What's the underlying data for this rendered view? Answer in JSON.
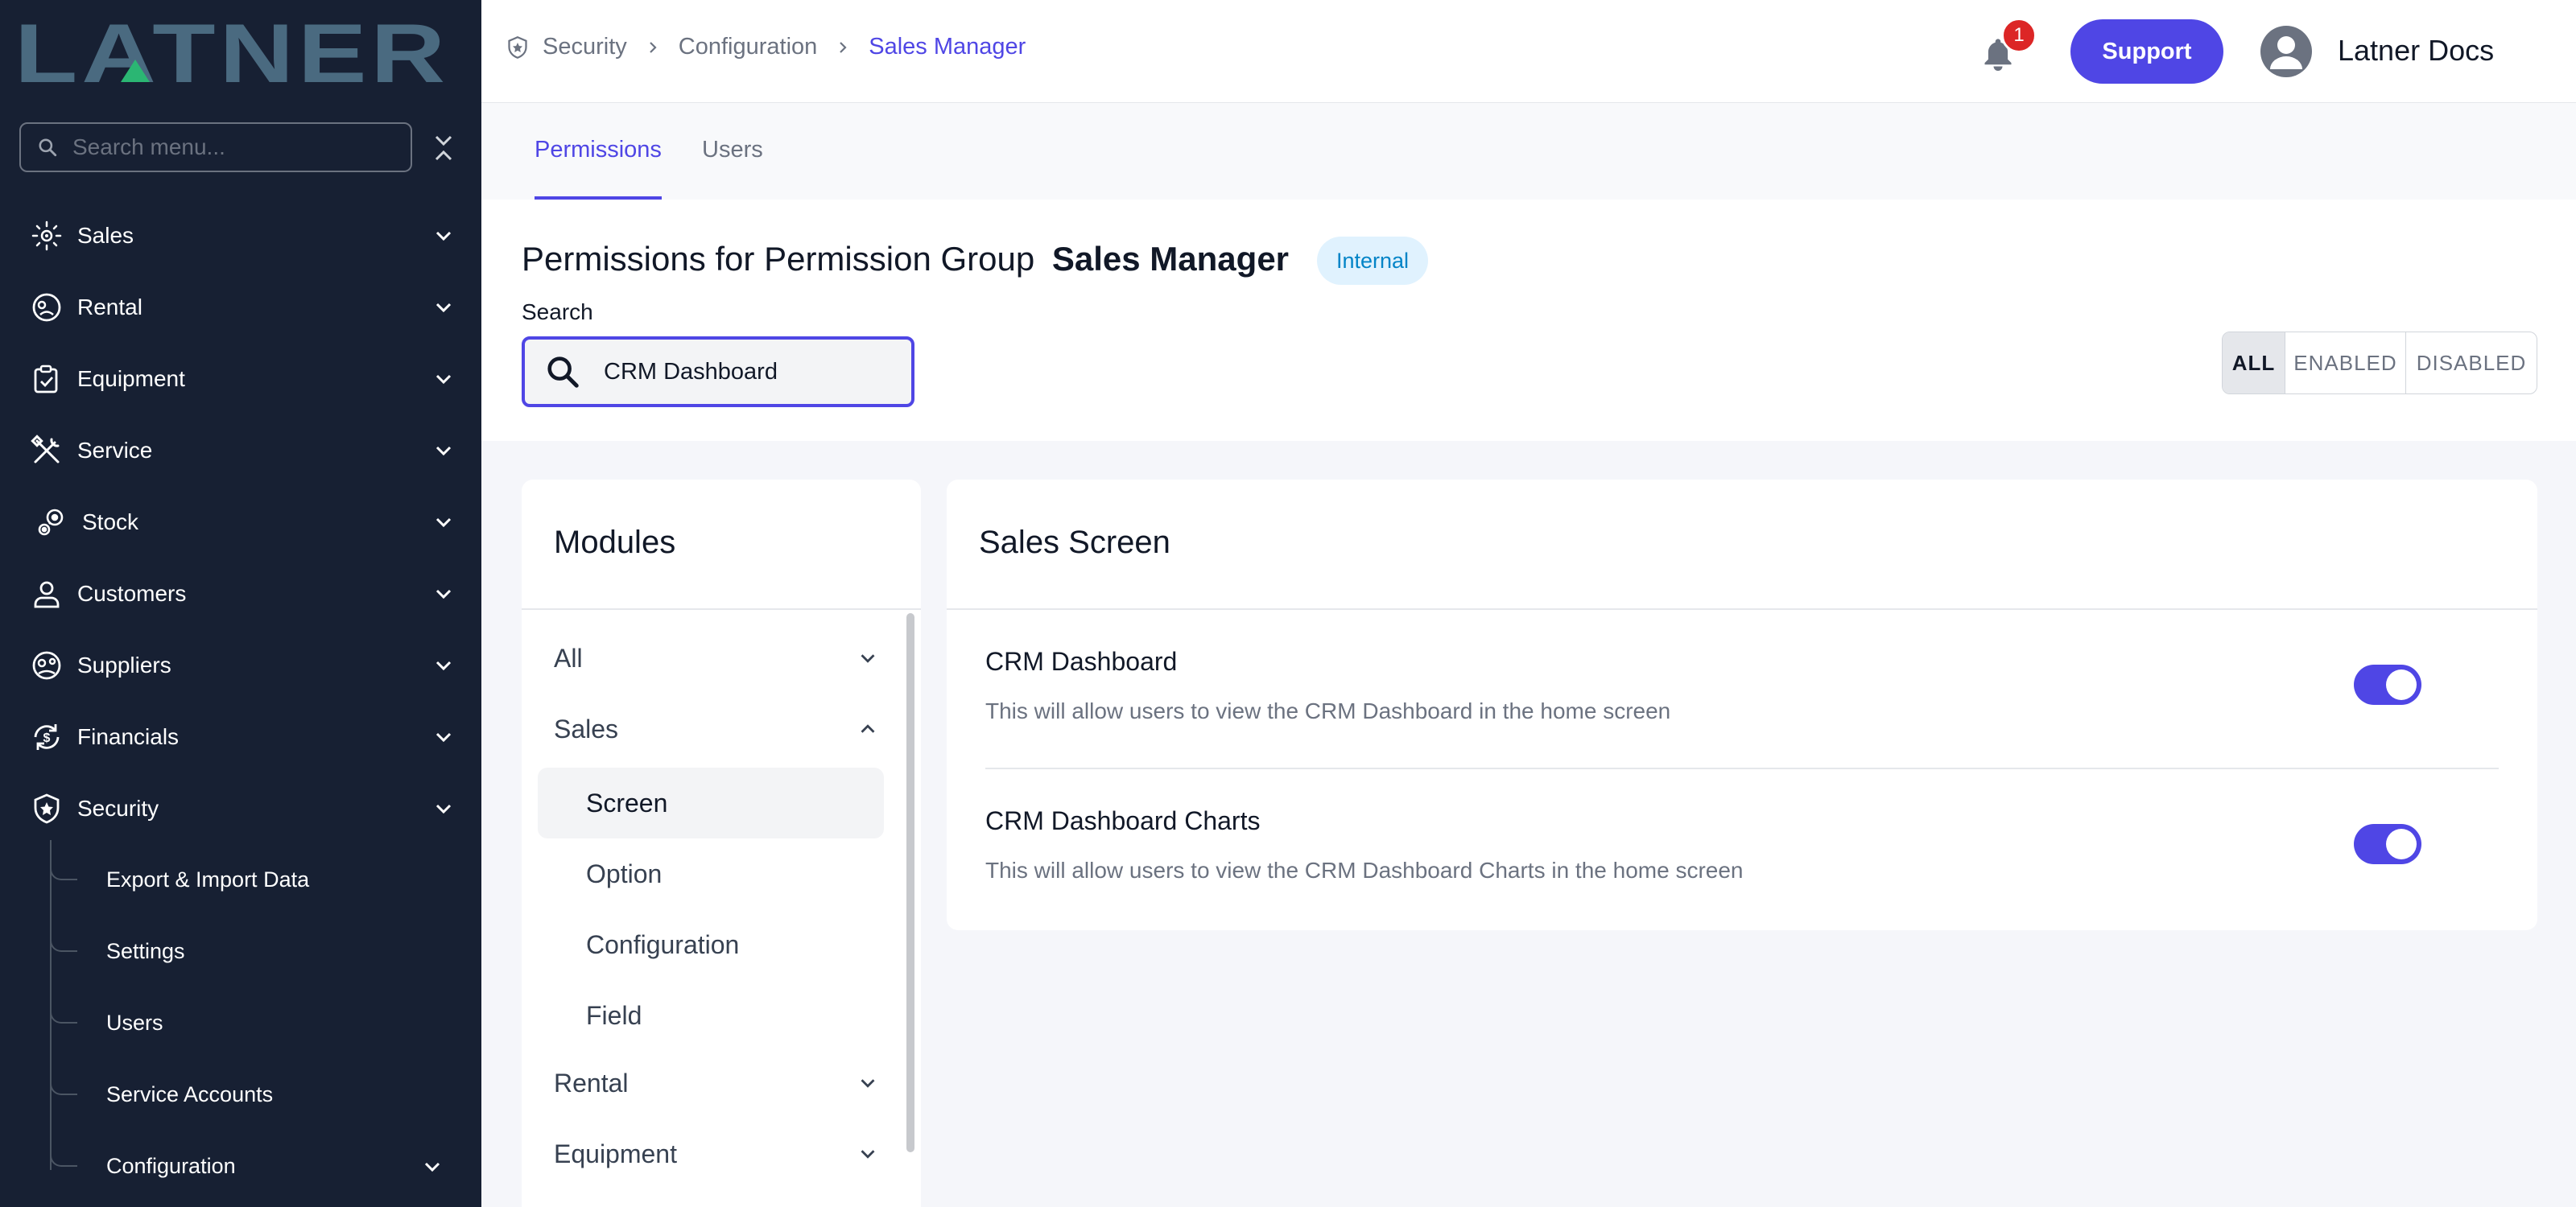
{
  "sidebar": {
    "logo_text": "LATNER",
    "search_placeholder": "Search menu...",
    "items": [
      {
        "label": "Sales",
        "icon": "sales-icon"
      },
      {
        "label": "Rental",
        "icon": "rental-icon"
      },
      {
        "label": "Equipment",
        "icon": "equipment-icon"
      },
      {
        "label": "Service",
        "icon": "service-icon"
      },
      {
        "label": "Stock",
        "icon": "stock-icon"
      },
      {
        "label": "Customers",
        "icon": "customers-icon"
      },
      {
        "label": "Suppliers",
        "icon": "suppliers-icon"
      },
      {
        "label": "Financials",
        "icon": "financials-icon"
      },
      {
        "label": "Security",
        "icon": "shield-icon"
      }
    ],
    "security_children": [
      {
        "label": "Export & Import Data"
      },
      {
        "label": "Settings"
      },
      {
        "label": "Users"
      },
      {
        "label": "Service Accounts"
      },
      {
        "label": "Configuration"
      }
    ]
  },
  "header": {
    "breadcrumb": [
      "Security",
      "Configuration",
      "Sales Manager"
    ],
    "notification_count": "1",
    "support_label": "Support",
    "user_name": "Latner Docs"
  },
  "tabs": [
    {
      "label": "Permissions",
      "active": true
    },
    {
      "label": "Users",
      "active": false
    }
  ],
  "page": {
    "title_prefix": "Permissions for Permission Group",
    "group_name": "Sales Manager",
    "badge": "Internal",
    "search_label": "Search",
    "search_value": "CRM Dashboard",
    "filters": [
      "ALL",
      "ENABLED",
      "DISABLED"
    ],
    "active_filter": "ALL"
  },
  "modules": {
    "heading": "Modules",
    "items": [
      {
        "label": "All",
        "expanded": false
      },
      {
        "label": "Sales",
        "expanded": true,
        "children": [
          "Screen",
          "Option",
          "Configuration",
          "Field"
        ],
        "active_child": "Screen"
      },
      {
        "label": "Rental",
        "expanded": false
      },
      {
        "label": "Equipment",
        "expanded": false
      }
    ]
  },
  "screen": {
    "heading": "Sales Screen",
    "permissions": [
      {
        "title": "CRM Dashboard",
        "description": "This will allow users to view the CRM Dashboard in the home screen",
        "enabled": true
      },
      {
        "title": "CRM Dashboard Charts",
        "description": "This will allow users to view the CRM Dashboard Charts in the home screen",
        "enabled": true
      }
    ]
  },
  "colors": {
    "sidebar_bg": "#172033",
    "accent": "#4f46e5",
    "logo": "#4a6a80",
    "logo_accent": "#2bb673",
    "badge_bg": "#e0f2fe",
    "badge_text": "#0284c7",
    "notification": "#dc2626"
  }
}
